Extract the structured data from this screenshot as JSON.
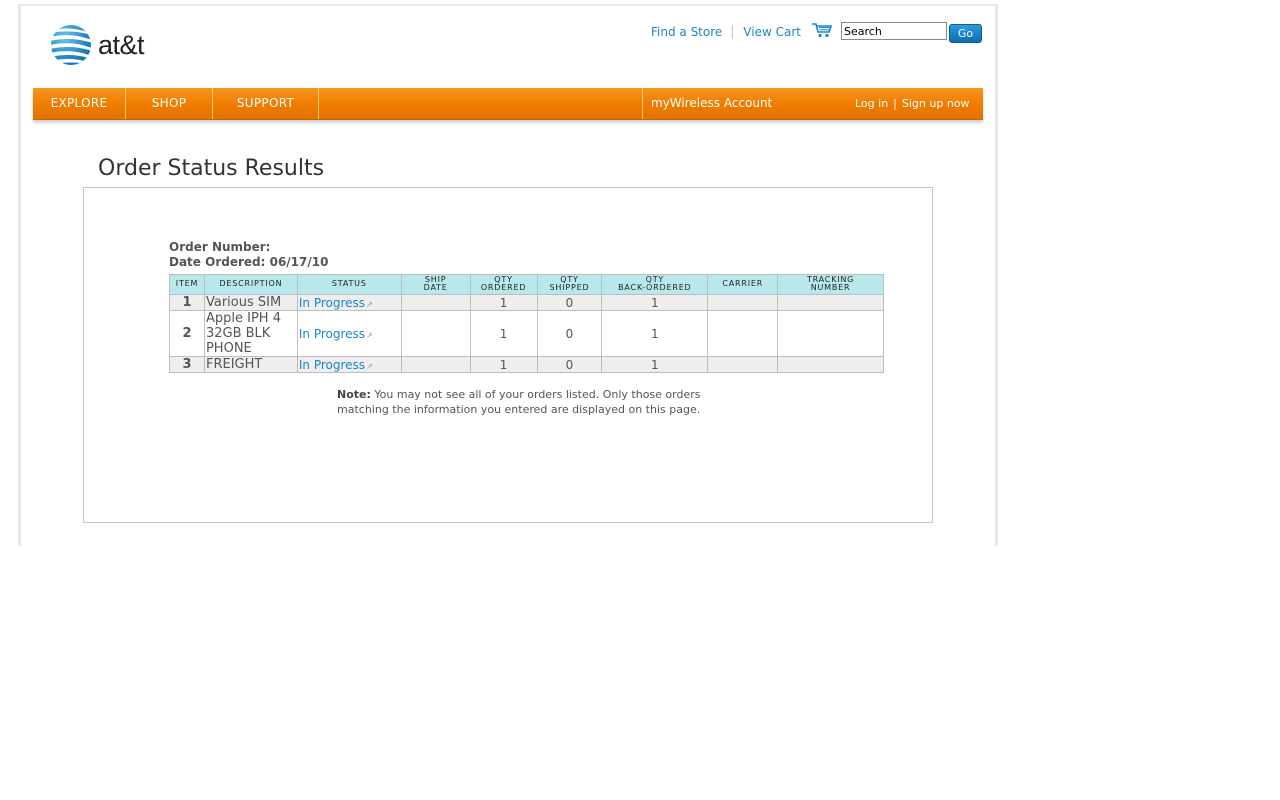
{
  "header": {
    "brand": "at&t",
    "find_store": "Find a Store",
    "view_cart": "View Cart",
    "search_value": "Search",
    "go_label": "Go"
  },
  "nav": {
    "explore": "EXPLORE",
    "shop": "SHOP",
    "support": "SUPPORT",
    "account": "myWireless Account",
    "login": "Log in",
    "separator": "|",
    "signup": "Sign up now"
  },
  "page": {
    "title": "Order Status Results",
    "order_number_label": "Order Number:",
    "date_ordered_label": "Date Ordered:",
    "date_ordered": "06/17/10"
  },
  "table": {
    "headers": {
      "item": "ITEM",
      "description": "DESCRIPTION",
      "status": "STATUS",
      "ship_date_1": "SHIP",
      "ship_date_2": "DATE",
      "qty_ordered_1": "QTY",
      "qty_ordered_2": "ORDERED",
      "qty_shipped_1": "QTY",
      "qty_shipped_2": "SHIPPED",
      "qty_back_1": "QTY",
      "qty_back_2": "BACK-ORDERED",
      "carrier": "CARRIER",
      "tracking_1": "TRACKING",
      "tracking_2": "NUMBER"
    },
    "rows": [
      {
        "item": "1",
        "desc": "Various SIM",
        "status": "In Progress",
        "ship_date": "",
        "qty_ordered": "1",
        "qty_shipped": "0",
        "qty_back": "1",
        "carrier": "",
        "tracking": ""
      },
      {
        "item": "2",
        "desc_line1": "Apple IPH 4",
        "desc_line2": "32GB BLK",
        "desc_line3": "PHONE",
        "status": "In Progress",
        "ship_date": "",
        "qty_ordered": "1",
        "qty_shipped": "0",
        "qty_back": "1",
        "carrier": "",
        "tracking": ""
      },
      {
        "item": "3",
        "desc": "FREIGHT",
        "status": "In Progress",
        "ship_date": "",
        "qty_ordered": "1",
        "qty_shipped": "0",
        "qty_back": "1",
        "carrier": "",
        "tracking": ""
      }
    ]
  },
  "note": {
    "label": "Note:",
    "text": "You may not see all of your orders listed. Only those orders matching the information you entered are displayed on this page."
  },
  "colors": {
    "nav_orange": "#ef7b00",
    "link_blue": "#1b87c9",
    "header_cyan": "#b8e8ec"
  }
}
